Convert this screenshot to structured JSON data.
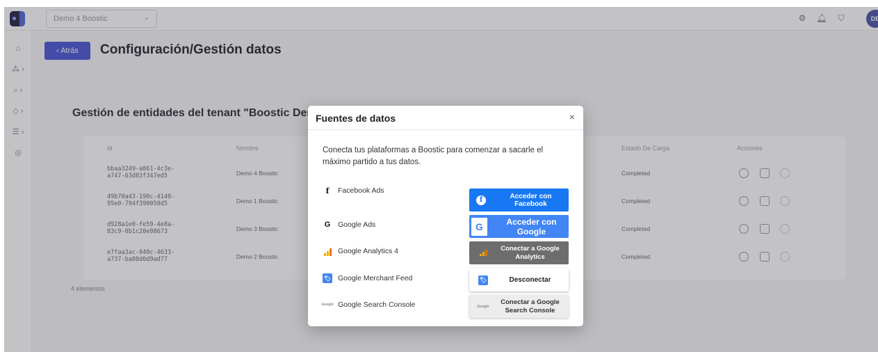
{
  "app": {
    "tenant_select_value": "Demo 4 Boostic",
    "avatar_initials": "DE"
  },
  "page": {
    "back_label": "‹ Atrás",
    "title": "Configuración/Gestión datos",
    "section_title": "Gestión de entidades del tenant \"Boostic Demo\"",
    "count_text": "4 elementos"
  },
  "table": {
    "columns": {
      "id": "Id",
      "name": "Nombre",
      "load_status": "Estado De Carga",
      "actions": "Acciones"
    },
    "rows": [
      {
        "id_line1": "bbaa3249-a861-4c3e-",
        "id_line2": "a747-63d83f347ed5",
        "name": "Demo 4 Boostic",
        "status": "Completed"
      },
      {
        "id_line1": "49b70a43-190c-4148-",
        "id_line2": "95e0-794f390050d5",
        "name": "Demo 1 Boostic",
        "status": "Completed"
      },
      {
        "id_line1": "d928a1e0-fe59-4e8a-",
        "id_line2": "83c9-0b1c20e80673",
        "name": "Demo 3 Boostic",
        "status": "Completed"
      },
      {
        "id_line1": "e7faa3ac-840c-4633-",
        "id_line2": "a737-ba08d6d9ad77",
        "name": "Demo 2 Boostic",
        "status": "Completed"
      }
    ]
  },
  "modal": {
    "title": "Fuentes de datos",
    "close": "×",
    "description": "Conecta tus plataformas a Boostic para comenzar a sacarle el máximo partido a tus datos.",
    "sources": [
      {
        "label": "Facebook Ads",
        "button": "Acceder con Facebook"
      },
      {
        "label": "Google Ads",
        "button": "Acceder con Google"
      },
      {
        "label": "Google Analytics 4",
        "button_line1": "Conectar a Google",
        "button_line2": "Analytics"
      },
      {
        "label": "Google Merchant Feed",
        "button": "Desconectar"
      },
      {
        "label": "Google Search Console",
        "button_line1": "Conectar a Google",
        "button_line2": "Search Console"
      }
    ]
  },
  "icons": {
    "facebook": "f",
    "google": "G",
    "gsc_mini": "Google"
  },
  "colors": {
    "accent": "#4f5bd5",
    "facebook_blue": "#1877f2",
    "google_blue": "#4285f4",
    "analytics_gray": "#6d6d6d"
  }
}
